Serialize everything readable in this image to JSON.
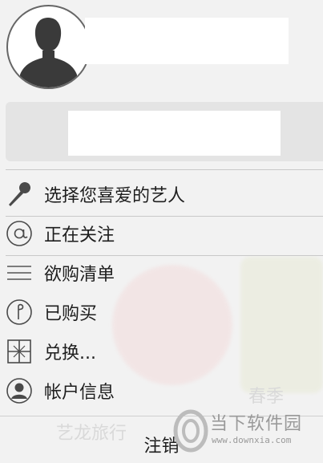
{
  "menu": {
    "items": [
      {
        "id": "artists",
        "label": "选择您喜爱的艺人",
        "icon": "microphone-icon"
      },
      {
        "id": "following",
        "label": "正在关注",
        "icon": "at-sign-icon"
      },
      {
        "id": "wishlist",
        "label": "欲购清单",
        "icon": "list-lines-icon"
      },
      {
        "id": "purchased",
        "label": "已购买",
        "icon": "purchased-circle-icon"
      },
      {
        "id": "redeem",
        "label": "兑换...",
        "icon": "gift-icon"
      },
      {
        "id": "account",
        "label": "帐户信息",
        "icon": "account-person-icon"
      }
    ]
  },
  "logout_label": "注销",
  "watermark": {
    "text": "当下软件园",
    "url": "www.downxia.com"
  },
  "background": {
    "text_1": "艺龙旅行",
    "text_2": "春季"
  }
}
